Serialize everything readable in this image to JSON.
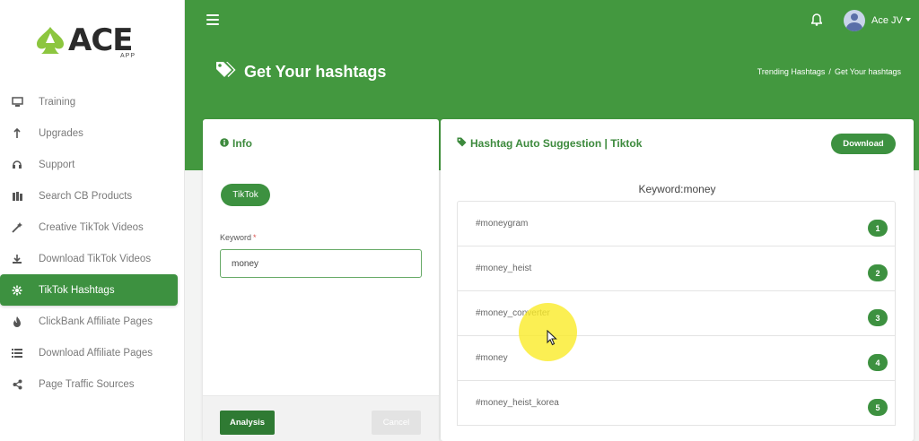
{
  "app": {
    "logo_text": "ACE",
    "logo_sub": "APP"
  },
  "sidebar": {
    "items": [
      {
        "label": "Training",
        "icon": "monitor-icon"
      },
      {
        "label": "Upgrades",
        "icon": "arrow-up-icon"
      },
      {
        "label": "Support",
        "icon": "headset-icon"
      },
      {
        "label": "Search CB Products",
        "icon": "books-icon"
      },
      {
        "label": "Creative TikTok Videos",
        "icon": "magic-wand-icon"
      },
      {
        "label": "Download TikTok Videos",
        "icon": "download-icon"
      },
      {
        "label": "TikTok Hashtags",
        "icon": "hashtag-icon",
        "active": true
      },
      {
        "label": "ClickBank Affiliate Pages",
        "icon": "fire-icon"
      },
      {
        "label": "Download Affiliate Pages",
        "icon": "list-icon"
      },
      {
        "label": "Page Traffic Sources",
        "icon": "share-icon"
      }
    ]
  },
  "header": {
    "user_name": "Ace JV",
    "page_title": "Get Your hashtags",
    "breadcrumb": [
      "Trending Hashtags",
      "/",
      "Get Your hashtags"
    ]
  },
  "info_card": {
    "title": "Info",
    "platform_button": "TikTok",
    "keyword_label": "Keyword",
    "required_mark": "*",
    "keyword_value": "money",
    "analysis_button": "Analysis",
    "cancel_button": "Cancel"
  },
  "suggestion_card": {
    "title": "Hashtag Auto Suggestion | Tiktok",
    "download_button": "Download",
    "keyword_title": "Keyword:money",
    "hashtags": [
      {
        "tag": "#moneygram",
        "rank": "1"
      },
      {
        "tag": "#money_heist",
        "rank": "2"
      },
      {
        "tag": "#money_converter",
        "rank": "3"
      },
      {
        "tag": "#money",
        "rank": "4"
      },
      {
        "tag": "#money_heist_korea",
        "rank": "5"
      }
    ]
  },
  "colors": {
    "brand_green": "#43983f",
    "active_green": "#3d9140",
    "highlight": "#faeb28"
  }
}
